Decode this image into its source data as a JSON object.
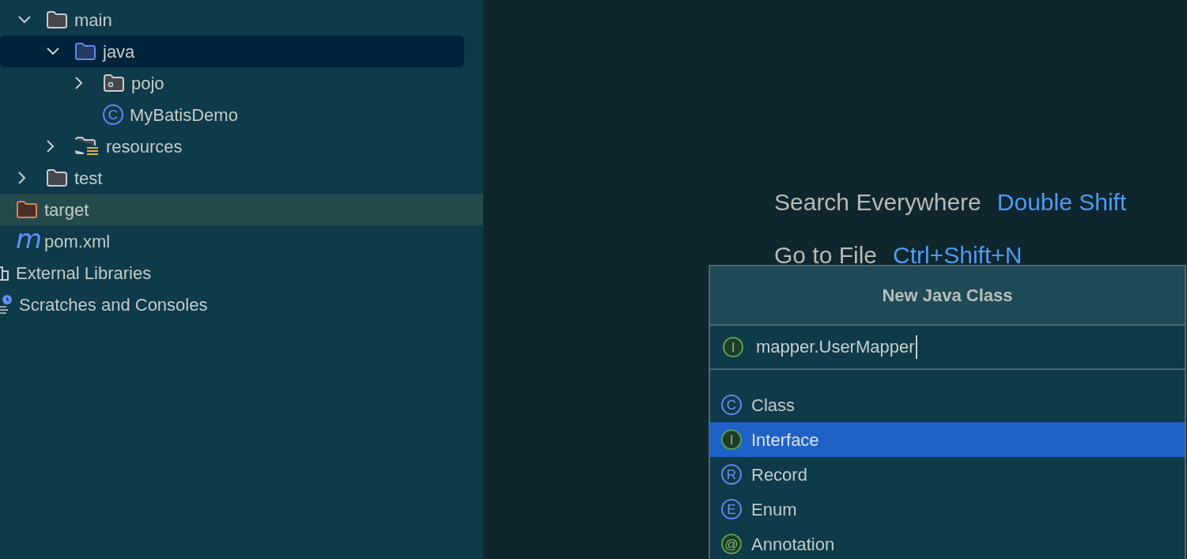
{
  "src_tree": [
    {
      "label": "main",
      "kind": "folder",
      "expanded": true,
      "selected": false,
      "hovered": false,
      "children": [
        {
          "label": "java",
          "kind": "source-folder",
          "expanded": true,
          "selected": true,
          "hovered": false,
          "children": [
            {
              "label": "pojo",
              "kind": "package",
              "expanded": false,
              "selected": false,
              "hovered": false
            },
            {
              "label": "MyBatisDemo",
              "kind": "class",
              "badge": "C",
              "selected": false,
              "hovered": false
            }
          ]
        },
        {
          "label": "resources",
          "kind": "resource-folder",
          "expanded": false,
          "selected": false,
          "hovered": false
        }
      ]
    },
    {
      "label": "test",
      "kind": "folder",
      "expanded": false,
      "selected": false,
      "hovered": false
    }
  ],
  "project_files": [
    {
      "label": "target",
      "kind": "excluded-folder",
      "selected": false,
      "hovered": true
    },
    {
      "label": "pom.xml",
      "kind": "maven",
      "badge": "m",
      "selected": false,
      "hovered": false
    }
  ],
  "roots": [
    {
      "label": "External Libraries",
      "kind": "libraries",
      "selected": false,
      "hovered": false
    },
    {
      "label": "Scratches and Consoles",
      "kind": "scratches",
      "selected": false,
      "hovered": false
    }
  ],
  "editor_hints": [
    {
      "action": "Search Everywhere",
      "shortcut": "Double Shift"
    },
    {
      "action": "Go to File",
      "shortcut": "Ctrl+Shift+N"
    }
  ],
  "dialog": {
    "title": "New Java Class",
    "field": {
      "badge": "I",
      "kind": "interface",
      "value": "mapper.UserMapper"
    },
    "options": [
      {
        "label": "Class",
        "badge": "C",
        "kind": "class",
        "selected": false
      },
      {
        "label": "Interface",
        "badge": "I",
        "kind": "interface",
        "selected": true
      },
      {
        "label": "Record",
        "badge": "R",
        "kind": "class",
        "selected": false
      },
      {
        "label": "Enum",
        "badge": "E",
        "kind": "class",
        "selected": false
      },
      {
        "label": "Annotation",
        "badge": "@",
        "kind": "interface",
        "selected": false
      }
    ]
  }
}
